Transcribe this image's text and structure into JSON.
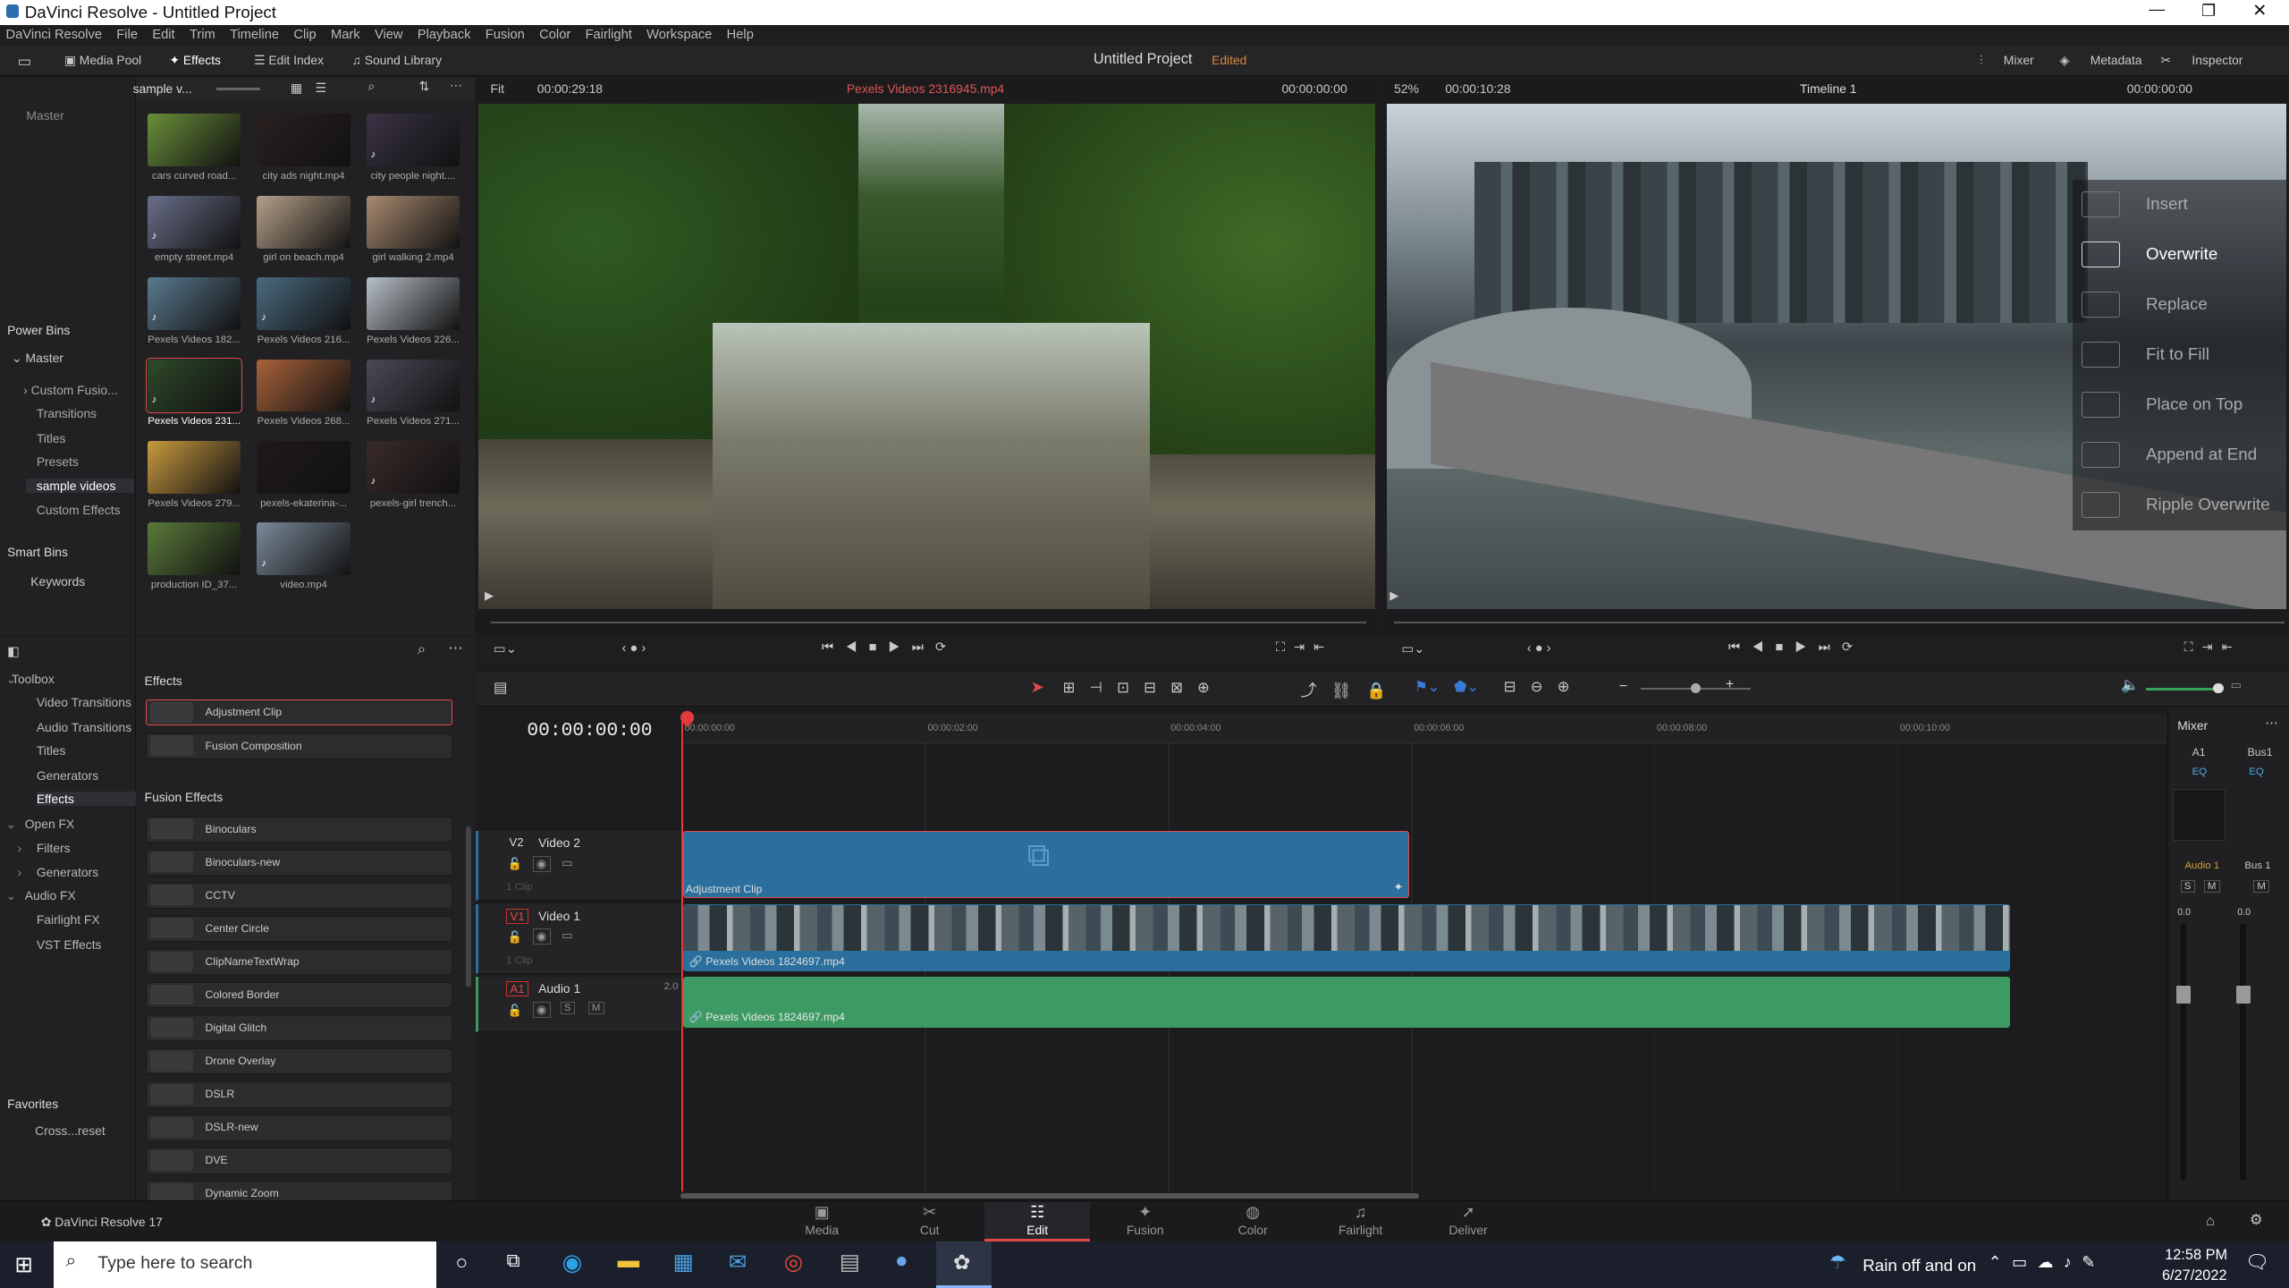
{
  "window": {
    "title": "DaVinci Resolve - Untitled Project"
  },
  "menu": [
    "DaVinci Resolve",
    "File",
    "Edit",
    "Trim",
    "Timeline",
    "Clip",
    "Mark",
    "View",
    "Playback",
    "Fusion",
    "Color",
    "Fairlight",
    "Workspace",
    "Help"
  ],
  "toolbar": {
    "media_pool": "Media Pool",
    "effects": "Effects",
    "edit_index": "Edit Index",
    "sound_library": "Sound Library",
    "project_title": "Untitled Project",
    "status": "Edited",
    "mixer": "Mixer",
    "metadata": "Metadata",
    "inspector": "Inspector"
  },
  "mediapool": {
    "bin_name": "sample v...",
    "master": "Master",
    "clips": [
      "cars curved road...",
      "city ads night.mp4",
      "city people night....",
      "empty street.mp4",
      "girl on beach.mp4",
      "girl walking 2.mp4",
      "Pexels Videos 182...",
      "Pexels Videos 216...",
      "Pexels Videos 226...",
      "Pexels Videos 231...",
      "Pexels Videos 268...",
      "Pexels Videos 271...",
      "Pexels Videos 279...",
      "pexels-ekaterina-...",
      "pexels-girl trench...",
      "production ID_37...",
      "video.mp4"
    ]
  },
  "bins": {
    "power_bins": "Power Bins",
    "master": "Master",
    "items": [
      "Custom Fusio...",
      "Transitions",
      "Titles",
      "Presets",
      "sample videos",
      "Custom Effects"
    ],
    "smart_bins": "Smart Bins",
    "keywords": "Keywords"
  },
  "source": {
    "zoom": "Fit",
    "duration": "00:00:29:18",
    "clip_name": "Pexels Videos 2316945.mp4",
    "timecode": "00:00:00:00"
  },
  "program": {
    "zoom": "52%",
    "duration": "00:00:10:28",
    "timeline": "Timeline 1",
    "timecode": "00:00:00:00"
  },
  "edit_overlay": [
    "Insert",
    "Overwrite",
    "Replace",
    "Fit to Fill",
    "Place on Top",
    "Append at End",
    "Ripple Overwrite"
  ],
  "toolbox": {
    "root": "Toolbox",
    "items": [
      "Video Transitions",
      "Audio Transitions",
      "Titles",
      "Generators",
      "Effects"
    ],
    "openfx": "Open FX",
    "openfx_items": [
      "Filters",
      "Generators"
    ],
    "audiofx": "Audio FX",
    "audiofx_items": [
      "Fairlight FX",
      "VST Effects"
    ],
    "favorites": "Favorites",
    "favorites_items": [
      "Cross...reset"
    ]
  },
  "effects": {
    "section1": "Effects",
    "items1": [
      "Adjustment Clip",
      "Fusion Composition"
    ],
    "section2": "Fusion Effects",
    "items2": [
      "Binoculars",
      "Binoculars-new",
      "CCTV",
      "Center Circle",
      "ClipNameTextWrap",
      "Colored Border",
      "Digital Glitch",
      "Drone Overlay",
      "DSLR",
      "DSLR-new",
      "DVE",
      "Dynamic Zoom"
    ]
  },
  "timeline": {
    "timecode": "00:00:00:00",
    "ruler": [
      "00:00:00:00",
      "00:00:02:00",
      "00:00:04:00",
      "00:00:06:00",
      "00:00:08:00",
      "00:00:10:00"
    ],
    "tracks": [
      {
        "id": "V2",
        "name": "Video 2",
        "clips": "1 Clip"
      },
      {
        "id": "V1",
        "name": "Video 1",
        "clips": "1 Clip"
      },
      {
        "id": "A1",
        "name": "Audio 1",
        "ch": "2.0"
      }
    ],
    "adj_clip": "Adjustment Clip",
    "video_clip": "Pexels Videos 1824697.mp4",
    "audio_clip": "Pexels Videos 1824697.mp4"
  },
  "mixer": {
    "title": "Mixer",
    "ch1": "A1",
    "ch2": "Bus1",
    "eq": "EQ",
    "name1": "Audio 1",
    "name2": "Bus 1",
    "s": "S",
    "m": "M",
    "val1": "0.0",
    "val2": "0.0"
  },
  "pages": {
    "app": "DaVinci Resolve 17",
    "tabs": [
      "Media",
      "Cut",
      "Edit",
      "Fusion",
      "Color",
      "Fairlight",
      "Deliver"
    ],
    "active": "Edit"
  },
  "taskbar": {
    "search": "Type here to search",
    "weather": "Rain off and on",
    "time": "12:58 PM",
    "date": "6/27/2022"
  },
  "colors": {
    "accent": "#e24a4a",
    "clip_blue": "#2a6f9d",
    "audio_green": "#3d9a62",
    "playhead": "#e23b3b"
  }
}
